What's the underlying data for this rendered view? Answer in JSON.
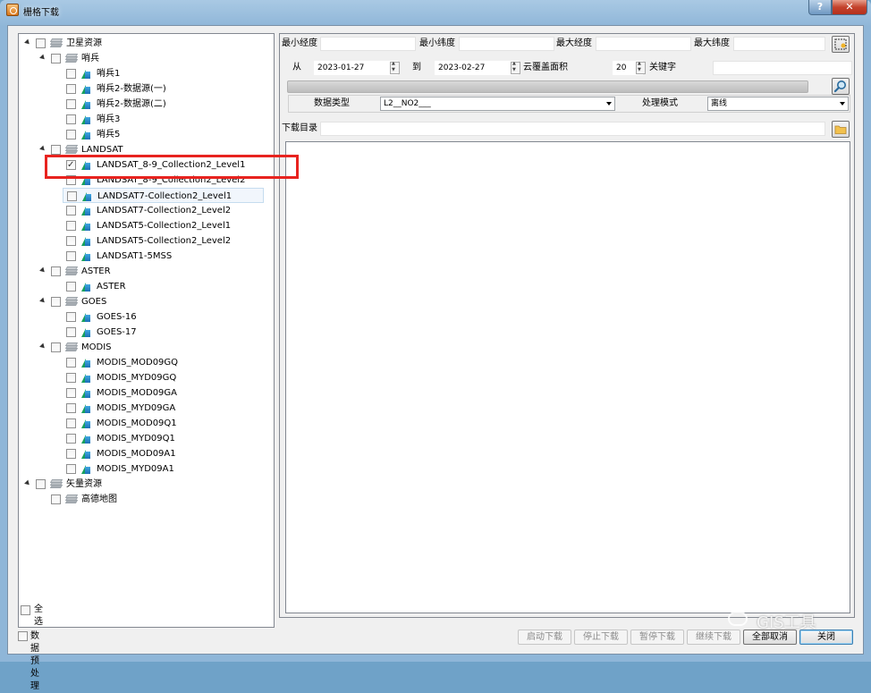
{
  "window": {
    "title": "栅格下载",
    "help_label": "?",
    "close_label": "✕"
  },
  "tree": [
    {
      "label": "卫星资源",
      "level": 0,
      "kind": "folder",
      "expanded": true,
      "checked": false
    },
    {
      "label": "哨兵",
      "level": 1,
      "kind": "folder",
      "expanded": true,
      "checked": false
    },
    {
      "label": "哨兵1",
      "level": 2,
      "kind": "raster",
      "checked": false
    },
    {
      "label": "哨兵2-数据源(一)",
      "level": 2,
      "kind": "raster",
      "checked": false
    },
    {
      "label": "哨兵2-数据源(二)",
      "level": 2,
      "kind": "raster",
      "checked": false
    },
    {
      "label": "哨兵3",
      "level": 2,
      "kind": "raster",
      "checked": false
    },
    {
      "label": "哨兵5",
      "level": 2,
      "kind": "raster",
      "checked": false
    },
    {
      "label": "LANDSAT",
      "level": 1,
      "kind": "folder",
      "expanded": true,
      "checked": false
    },
    {
      "label": "LANDSAT_8-9_Collection2_Level1",
      "level": 2,
      "kind": "raster",
      "checked": true
    },
    {
      "label": "LANDSAT_8-9_Collection2_Level2",
      "level": 2,
      "kind": "raster",
      "checked": false
    },
    {
      "label": "LANDSAT7-Collection2_Level1",
      "level": 2,
      "kind": "raster",
      "checked": false,
      "selected": true
    },
    {
      "label": "LANDSAT7-Collection2_Level2",
      "level": 2,
      "kind": "raster",
      "checked": false
    },
    {
      "label": "LANDSAT5-Collection2_Level1",
      "level": 2,
      "kind": "raster",
      "checked": false
    },
    {
      "label": "LANDSAT5-Collection2_Level2",
      "level": 2,
      "kind": "raster",
      "checked": false
    },
    {
      "label": "LANDSAT1-5MSS",
      "level": 2,
      "kind": "raster",
      "checked": false
    },
    {
      "label": "ASTER",
      "level": 1,
      "kind": "folder",
      "expanded": true,
      "checked": false
    },
    {
      "label": "ASTER",
      "level": 2,
      "kind": "raster",
      "checked": false
    },
    {
      "label": "GOES",
      "level": 1,
      "kind": "folder",
      "expanded": true,
      "checked": false
    },
    {
      "label": "GOES-16",
      "level": 2,
      "kind": "raster",
      "checked": false
    },
    {
      "label": "GOES-17",
      "level": 2,
      "kind": "raster",
      "checked": false
    },
    {
      "label": "MODIS",
      "level": 1,
      "kind": "folder",
      "expanded": true,
      "checked": false
    },
    {
      "label": "MODIS_MOD09GQ",
      "level": 2,
      "kind": "raster",
      "checked": false
    },
    {
      "label": "MODIS_MYD09GQ",
      "level": 2,
      "kind": "raster",
      "checked": false
    },
    {
      "label": "MODIS_MOD09GA",
      "level": 2,
      "kind": "raster",
      "checked": false
    },
    {
      "label": "MODIS_MYD09GA",
      "level": 2,
      "kind": "raster",
      "checked": false
    },
    {
      "label": "MODIS_MOD09Q1",
      "level": 2,
      "kind": "raster",
      "checked": false
    },
    {
      "label": "MODIS_MYD09Q1",
      "level": 2,
      "kind": "raster",
      "checked": false
    },
    {
      "label": "MODIS_MOD09A1",
      "level": 2,
      "kind": "raster",
      "checked": false
    },
    {
      "label": "MODIS_MYD09A1",
      "level": 2,
      "kind": "raster",
      "checked": false
    },
    {
      "label": "矢量资源",
      "level": 0,
      "kind": "folder",
      "expanded": true,
      "checked": false
    },
    {
      "label": "高德地图",
      "level": 1,
      "kind": "folder",
      "expanded": false,
      "checked": false
    }
  ],
  "left_footer": {
    "select_all": "全选",
    "preprocess": "数据预处理"
  },
  "bbox": {
    "min_lon_label": "最小经度",
    "min_lon_value": "",
    "min_lat_label": "最小纬度",
    "min_lat_value": "",
    "max_lon_label": "最大经度",
    "max_lon_value": "",
    "max_lat_label": "最大纬度",
    "max_lat_value": ""
  },
  "filters": {
    "from_label": "从",
    "from_date": "2023-01-27",
    "to_label": "到",
    "to_date": "2023-02-27",
    "cloud_label": "云覆盖面积",
    "cloud_value": "20",
    "keyword_label": "关键字",
    "keyword_value": ""
  },
  "progress": {
    "fraction": 0
  },
  "options": {
    "data_type_label": "数据类型",
    "data_type_value": "L2__NO2___",
    "mode_label": "处理模式",
    "mode_value": "离线"
  },
  "download_dir": {
    "label": "下载目录",
    "value": ""
  },
  "buttons": {
    "start": "启动下载",
    "stop": "停止下载",
    "pause": "暂停下载",
    "resume": "继续下载",
    "cancel_all": "全部取消",
    "close": "关闭"
  },
  "watermark": "GIS工具",
  "colors": {
    "highlight": "#e8231f",
    "selection": "#c5dcef"
  }
}
